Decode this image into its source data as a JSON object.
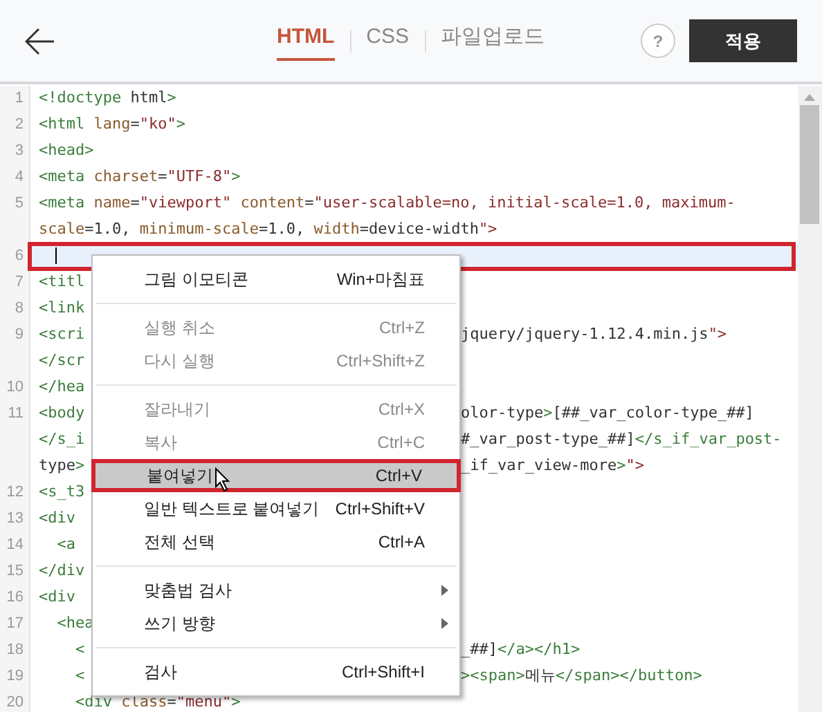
{
  "header": {
    "tabs": [
      {
        "label": "HTML",
        "selected": true
      },
      {
        "label": "CSS",
        "selected": false
      },
      {
        "label": "파일업로드",
        "selected": false
      }
    ],
    "help": "?",
    "apply_button": "적용"
  },
  "editor": {
    "lines": [
      {
        "number": "1",
        "text": "<!doctype html>",
        "current": false
      },
      {
        "number": "2",
        "text": "<html lang=\"ko\">",
        "current": false
      },
      {
        "number": "3",
        "text": "<head>",
        "current": false
      },
      {
        "number": "4",
        "text": "<meta charset=\"UTF-8\">",
        "current": false
      },
      {
        "number": "5",
        "text": "<meta name=\"viewport\" content=\"user-scalable=no, initial-scale=1.0, maximum-",
        "current": false
      },
      {
        "text": "scale=1.0, minimum-scale=1.0, width=device-width\">",
        "current": false
      },
      {
        "number": "6",
        "current": true
      },
      {
        "number": "7",
        "left": "<titl",
        "current": false
      },
      {
        "number": "8",
        "left": "<link",
        "current": false
      },
      {
        "number": "9",
        "left": "<scri",
        "right": "jquery/jquery-1.12.4.min.js\">",
        "current": false
      },
      {
        "left": "</scr",
        "current": false
      },
      {
        "number": "10",
        "left": "</hea",
        "current": false
      },
      {
        "number": "11",
        "left": "<body",
        "right": "olor-type>[##_var_color-type_##]",
        "current": false
      },
      {
        "left": "</s_i",
        "right": "#_var_post-type_##]</s_if_var_post-",
        "current": false
      },
      {
        "left": "type>",
        "right": "_if_var_view-more>\">",
        "current": false
      },
      {
        "number": "12",
        "left": "<s_t3",
        "current": false
      },
      {
        "number": "13",
        "left": "<div",
        "current": false
      },
      {
        "number": "14",
        "left": "  <a",
        "current": false
      },
      {
        "number": "15",
        "left": "</div",
        "current": false
      },
      {
        "number": "16",
        "left": "<div",
        "current": false
      },
      {
        "number": "17",
        "left": "  <hea",
        "current": false
      },
      {
        "number": "18",
        "left": "    <",
        "right": "_##]</a></h1>",
        "current": false
      },
      {
        "number": "19",
        "left": "    <",
        "right": "><span>메뉴</span></button>",
        "current": false
      },
      {
        "number": "20",
        "text": "    <div class=\"menu\">",
        "current": false
      }
    ]
  },
  "context_menu": {
    "items": [
      {
        "kind": "item",
        "label": "그림 이모티콘",
        "shortcut": "Win+마침표",
        "disabled": false,
        "selected": false,
        "submenu": false
      },
      {
        "kind": "separator"
      },
      {
        "kind": "item",
        "label": "실행 취소",
        "shortcut": "Ctrl+Z",
        "disabled": true,
        "selected": false,
        "submenu": false
      },
      {
        "kind": "item",
        "label": "다시 실행",
        "shortcut": "Ctrl+Shift+Z",
        "disabled": true,
        "selected": false,
        "submenu": false
      },
      {
        "kind": "separator"
      },
      {
        "kind": "item",
        "label": "잘라내기",
        "shortcut": "Ctrl+X",
        "disabled": true,
        "selected": false,
        "submenu": false
      },
      {
        "kind": "item",
        "label": "복사",
        "shortcut": "Ctrl+C",
        "disabled": true,
        "selected": false,
        "submenu": false
      },
      {
        "kind": "item",
        "label": "붙여넣기",
        "shortcut": "Ctrl+V",
        "disabled": false,
        "selected": true,
        "submenu": false
      },
      {
        "kind": "item",
        "label": "일반 텍스트로 붙여넣기",
        "shortcut": "Ctrl+Shift+V",
        "disabled": false,
        "selected": false,
        "submenu": false
      },
      {
        "kind": "item",
        "label": "전체 선택",
        "shortcut": "Ctrl+A",
        "disabled": false,
        "selected": false,
        "submenu": false
      },
      {
        "kind": "separator"
      },
      {
        "kind": "item",
        "label": "맞춤법 검사",
        "disabled": false,
        "selected": false,
        "submenu": true
      },
      {
        "kind": "item",
        "label": "쓰기 방향",
        "disabled": false,
        "selected": false,
        "submenu": true
      },
      {
        "kind": "separator"
      },
      {
        "kind": "item",
        "label": "검사",
        "shortcut": "Ctrl+Shift+I",
        "disabled": false,
        "selected": false,
        "submenu": false
      }
    ]
  }
}
